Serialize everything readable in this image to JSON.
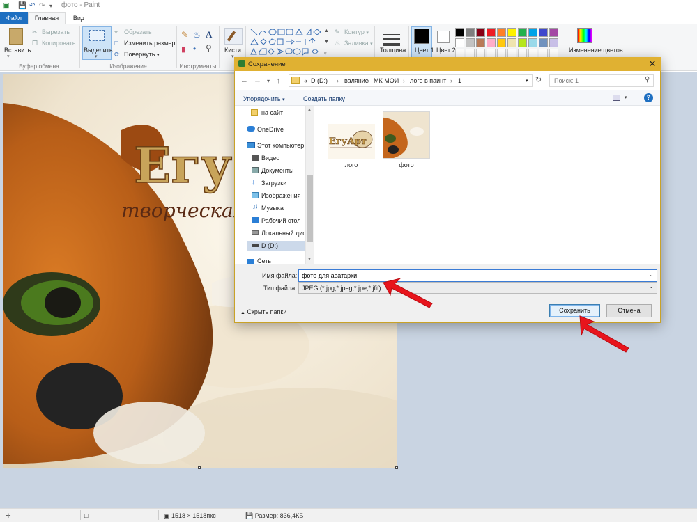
{
  "window": {
    "title": "фото - Paint"
  },
  "ribbon": {
    "tabs": {
      "file": "Файл",
      "home": "Главная",
      "view": "Вид"
    },
    "clipboard": {
      "paste": "Вставить",
      "cut": "Вырезать",
      "copy": "Копировать",
      "group": "Буфер обмена"
    },
    "image": {
      "select": "Выделить",
      "crop": "Обрезать",
      "resize": "Изменить размер",
      "rotate": "Повернуть",
      "group": "Изображение"
    },
    "tools": {
      "group": "Инструменты"
    },
    "brushes": {
      "label": "Кисти"
    },
    "shapes": {
      "outline": "Контур",
      "fill": "Заливка"
    },
    "size": {
      "label": "Толщина"
    },
    "color1": {
      "label": "Цвет 1"
    },
    "color2": {
      "label": "Цвет 2"
    },
    "edit_colors": {
      "label": "Изменение цветов"
    },
    "palette_row1": [
      "#000000",
      "#7f7f7f",
      "#880015",
      "#ed1c24",
      "#ff7f27",
      "#fff200",
      "#22b14c",
      "#00a2e8",
      "#3f48cc",
      "#a349a4"
    ],
    "palette_row2": [
      "#ffffff",
      "#c3c3c3",
      "#b97a57",
      "#ffaec9",
      "#ffc90e",
      "#efe4b0",
      "#b5e61d",
      "#99d9ea",
      "#7092be",
      "#c8bfe7"
    ]
  },
  "canvas_image": {
    "heading": "Егу",
    "subheading": "творческая"
  },
  "dialog": {
    "title": "Сохранение",
    "breadcrumb": [
      "«",
      "D (D:)",
      "›",
      "валяние",
      "›",
      "МК МОИ",
      "›",
      "лого в паинт",
      "›",
      "1"
    ],
    "search_placeholder": "Поиск: 1",
    "organize": "Упорядочить",
    "new_folder": "Создать папку",
    "nav_items": [
      {
        "label": "на сайт",
        "icon": "folder-icon"
      },
      {
        "label": "OneDrive",
        "icon": "cloud-icon"
      },
      {
        "label": "Этот компьютер",
        "icon": "computer-icon"
      },
      {
        "label": "Видео",
        "icon": "video-icon"
      },
      {
        "label": "Документы",
        "icon": "documents-icon"
      },
      {
        "label": "Загрузки",
        "icon": "downloads-icon"
      },
      {
        "label": "Изображения",
        "icon": "pictures-icon"
      },
      {
        "label": "Музыка",
        "icon": "music-icon"
      },
      {
        "label": "Рабочий стол",
        "icon": "desktop-icon"
      },
      {
        "label": "Локальный дис",
        "icon": "drive-icon"
      },
      {
        "label": "D (D:)",
        "icon": "drive-icon"
      },
      {
        "label": "Сеть",
        "icon": "network-icon"
      }
    ],
    "files": [
      {
        "name": "лого",
        "thumb_text": "ЕгуАрт"
      },
      {
        "name": "фото",
        "thumb_text": ""
      }
    ],
    "filename_label": "Имя файла:",
    "filename_value": "фото для аватарки",
    "filetype_label": "Тип файла:",
    "filetype_value": "JPEG (*.jpg;*.jpeg;*.jpe;*.jfif)",
    "save": "Сохранить",
    "cancel": "Отмена",
    "hide_folders": "Скрыть папки"
  },
  "statusbar": {
    "dimensions": "1518 × 1518пкс",
    "size": "Размер: 836,4КБ"
  },
  "colors": {
    "file_tab": "#1e6fc1",
    "dialog_titlebar": "#e0b132",
    "workspace": "#c9d4e2",
    "annotation_arrow": "#e8141c"
  }
}
